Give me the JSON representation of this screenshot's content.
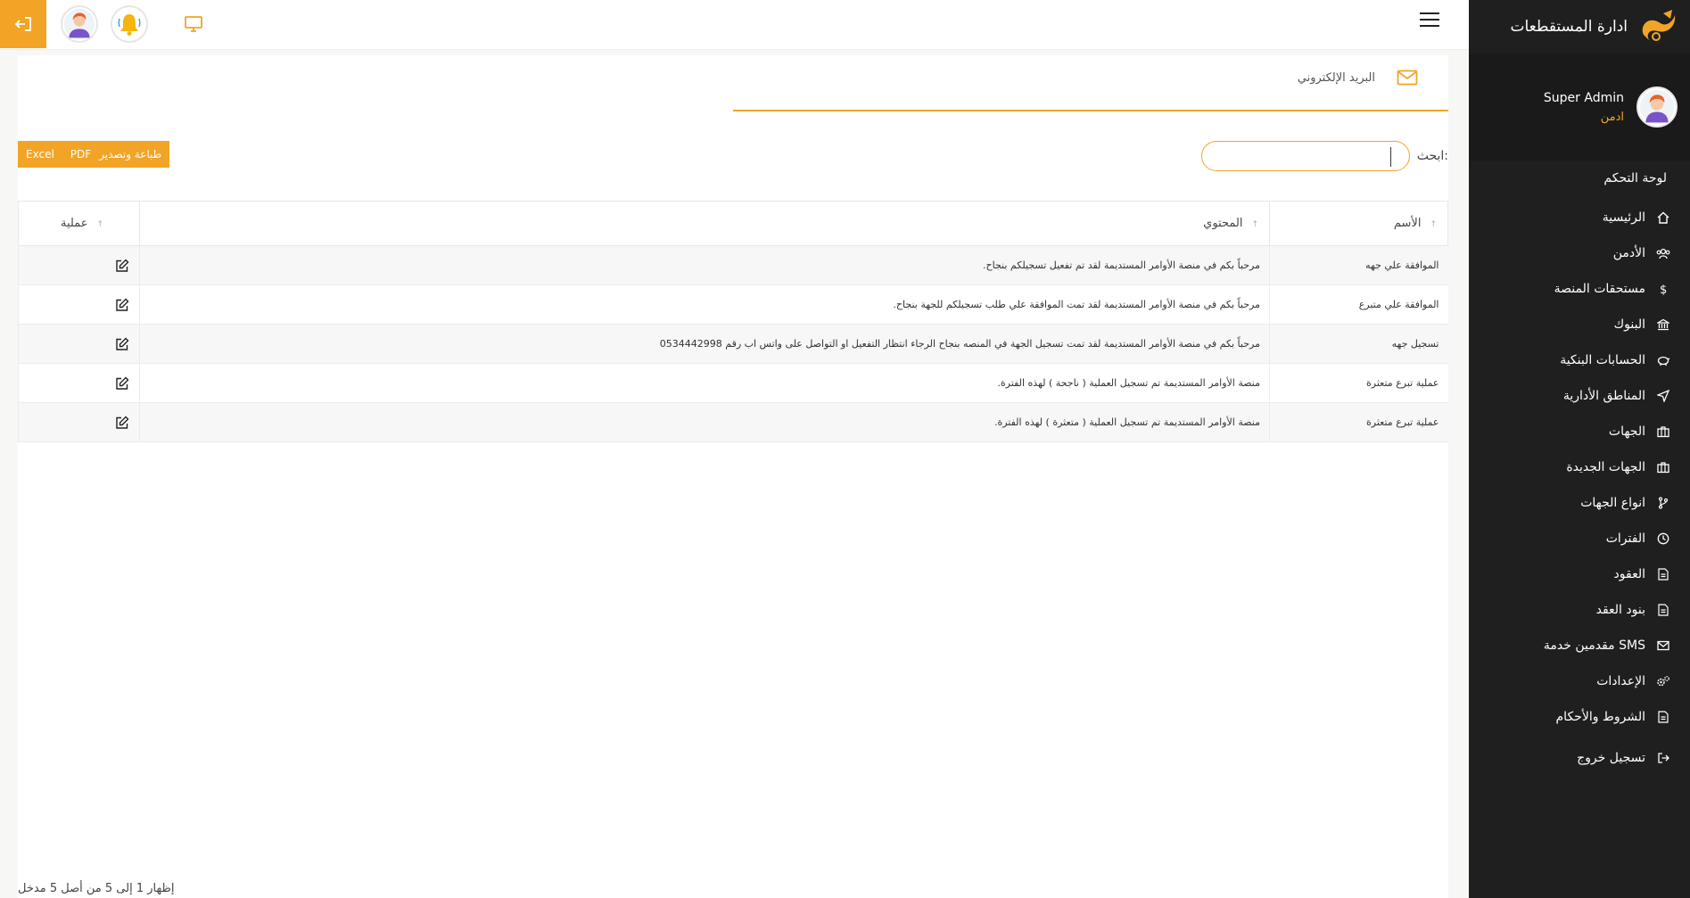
{
  "brand": {
    "name": "ادارة المستقطعات"
  },
  "user": {
    "name": "Super Admin",
    "role": "ادمن"
  },
  "nav": {
    "section_title": "لوحة التحكم",
    "items": [
      {
        "label": "الرئيسية",
        "icon": "home-icon"
      },
      {
        "label": "الأدمن",
        "icon": "users-icon"
      },
      {
        "label": "مستحقات المنصة",
        "icon": "dollar-icon"
      },
      {
        "label": "البنوك",
        "icon": "bank-icon"
      },
      {
        "label": "الحسابات البنكية",
        "icon": "piggy-bank-icon"
      },
      {
        "label": "المناطق الأدارية",
        "icon": "send-icon"
      },
      {
        "label": "الجهات",
        "icon": "briefcase-icon"
      },
      {
        "label": "الجهات الجديدة",
        "icon": "briefcase-icon"
      },
      {
        "label": "انواع الجهات",
        "icon": "branch-icon"
      },
      {
        "label": "الفترات",
        "icon": "clock-icon"
      },
      {
        "label": "العقود",
        "icon": "document-icon"
      },
      {
        "label": "بنود العقد",
        "icon": "document-icon"
      },
      {
        "label": "مقدمين خدمة SMS",
        "icon": "mail-icon"
      },
      {
        "label": "الإعدادات",
        "icon": "gears-icon"
      },
      {
        "label": "الشروط والأحكام",
        "icon": "document-icon"
      }
    ],
    "logout_label": "تسجيل خروج"
  },
  "tab": {
    "label": "البريد الإلكتروني"
  },
  "search": {
    "label": "ابحث:",
    "value": ""
  },
  "export": {
    "excel": "Excel",
    "pdf": "PDF",
    "print": "طباعة وتصدير"
  },
  "table": {
    "headers": {
      "name": "الأسم",
      "content": "المحتوي",
      "action": "عملية"
    },
    "sort_icon": "↑",
    "rows": [
      {
        "name": "الموافقة علي جهه",
        "content": "مرحباً بكم في منصة الأوامر المستديمة لقد تم تفعيل تسجيلكم بنجاح."
      },
      {
        "name": "الموافقة علي متبرع",
        "content": "مرحباً بكم في منصة الأوامر المستديمة لقد تمت الموافقة علي طلب تسجيلكم للجهة بنجاح."
      },
      {
        "name": "تسجيل جهه",
        "content": "مرحباً بكم في منصة الأوامر المستديمة لقد تمت تسجيل الجهة في المنصه بنجاح الرجاء انتظار التفعيل او التواصل على واتس اب رقم 0534442998"
      },
      {
        "name": "عملية تبرع متعثرة",
        "content": "منصة الأوامر المستديمة تم تسجيل العملية ( ناجحة ) لهذه الفترة."
      },
      {
        "name": "عملية تبرع متعثرة",
        "content": "منصة الأوامر المستديمة تم تسجيل العملية ( متعثرة ) لهذه الفترة."
      }
    ]
  },
  "footer": {
    "info": "إظهار 1 إلى 5 من أصل 5 مدخل"
  },
  "colors": {
    "accent": "#f2a427",
    "sidebar": "#1f1f1f"
  }
}
